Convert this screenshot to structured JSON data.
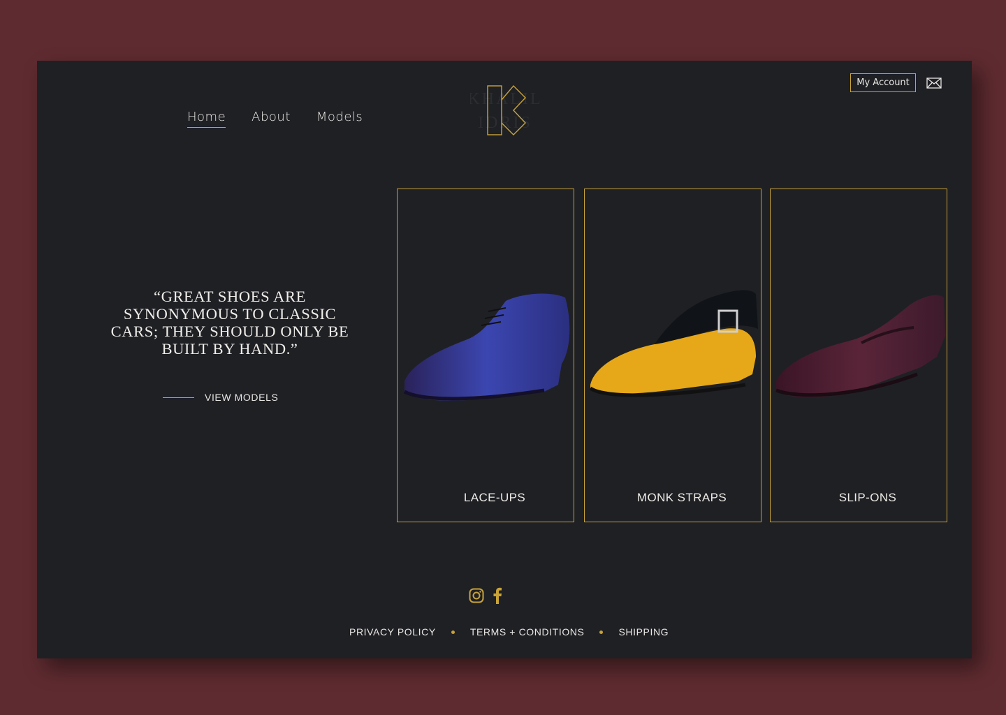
{
  "nav": {
    "items": [
      {
        "label": "Home",
        "active": true
      },
      {
        "label": "About",
        "active": false
      },
      {
        "label": "Models",
        "active": false
      }
    ]
  },
  "header": {
    "logo_text": "KHALIL IDRIS",
    "account_label": "My Account"
  },
  "hero": {
    "quote": "“GREAT SHOES ARE SYNONYMOUS TO CLASSIC CARS; THEY SHOULD ONLY BE BUILT BY HAND.”",
    "cta_label": "VIEW MODELS"
  },
  "categories": [
    {
      "label": "LACE-UPS",
      "color": "#3a3f9a"
    },
    {
      "label": "MONK STRAPS",
      "color": "#e6a818"
    },
    {
      "label": "SLIP-ONS",
      "color": "#4a1f33"
    }
  ],
  "footer": {
    "links": [
      "PRIVACY POLICY",
      "TERMS + CONDITIONS",
      "SHIPPING"
    ]
  },
  "colors": {
    "accent": "#c9a33a",
    "page_bg": "#5e2b30",
    "panel_bg": "#1f2024"
  }
}
